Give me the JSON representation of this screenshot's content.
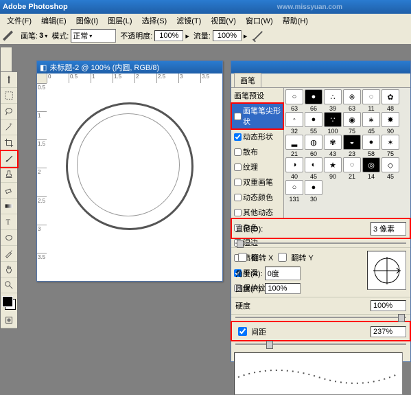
{
  "app": {
    "title": "Adobe Photoshop",
    "watermark": "www.missyuan.com"
  },
  "menu": [
    "文件(F)",
    "编辑(E)",
    "图像(I)",
    "图层(L)",
    "选择(S)",
    "滤镜(T)",
    "视图(V)",
    "窗口(W)",
    "帮助(H)"
  ],
  "options": {
    "brush_label": "画笔:",
    "brush_size": "3",
    "mode_label": "模式:",
    "mode_value": "正常",
    "opacity_label": "不透明度:",
    "opacity_value": "100%",
    "flow_label": "流量:",
    "flow_value": "100%"
  },
  "document": {
    "title": "未标题-2 @ 100% (内圆, RGB/8)",
    "rulers_h": [
      "0",
      "0.5",
      "1",
      "1.5",
      "2",
      "2.5",
      "3",
      "3.5"
    ],
    "rulers_v": [
      "0.5",
      "1",
      "1.5",
      "2",
      "2.5",
      "3",
      "3.5"
    ]
  },
  "brush_panel": {
    "tab": "画笔",
    "list": [
      {
        "label": "画笔预设",
        "chk": false
      },
      {
        "label": "画笔笔尖形状",
        "chk": false,
        "hl": true
      },
      {
        "label": "动态形状",
        "chk": true
      },
      {
        "label": "散布",
        "chk": false
      },
      {
        "label": "纹理",
        "chk": false
      },
      {
        "label": "双重画笔",
        "chk": false
      },
      {
        "label": "动态颜色",
        "chk": false
      },
      {
        "label": "其他动态",
        "chk": false
      },
      {
        "label": "杂色",
        "chk": false
      },
      {
        "label": "湿边",
        "chk": false
      },
      {
        "label": "喷枪",
        "chk": false
      },
      {
        "label": "平滑",
        "chk": true
      },
      {
        "label": "保护纹理",
        "chk": false
      }
    ],
    "tips_rows": [
      [
        "63",
        "66",
        "39",
        "63",
        "11",
        "48"
      ],
      [
        "32",
        "55",
        "100",
        "75",
        "45",
        "90"
      ],
      [
        "21",
        "60",
        "43",
        "23",
        "58",
        "75"
      ],
      [
        "40",
        "45",
        "90",
        "21",
        "14",
        "45"
      ],
      [
        "131",
        "30",
        "",
        "",
        "",
        ""
      ]
    ],
    "diameter": {
      "label": "直径(D):",
      "value": "3 像素"
    },
    "flip": {
      "x": "翻转 X",
      "y": "翻转 Y"
    },
    "angle": {
      "label": "角度(A):",
      "value": "0度"
    },
    "roundness": {
      "label": "圆度(R):",
      "value": "100%"
    },
    "hardness": {
      "label": "硬度",
      "value": "100%"
    },
    "spacing": {
      "label": "间距",
      "value": "237%",
      "chk": true
    }
  }
}
